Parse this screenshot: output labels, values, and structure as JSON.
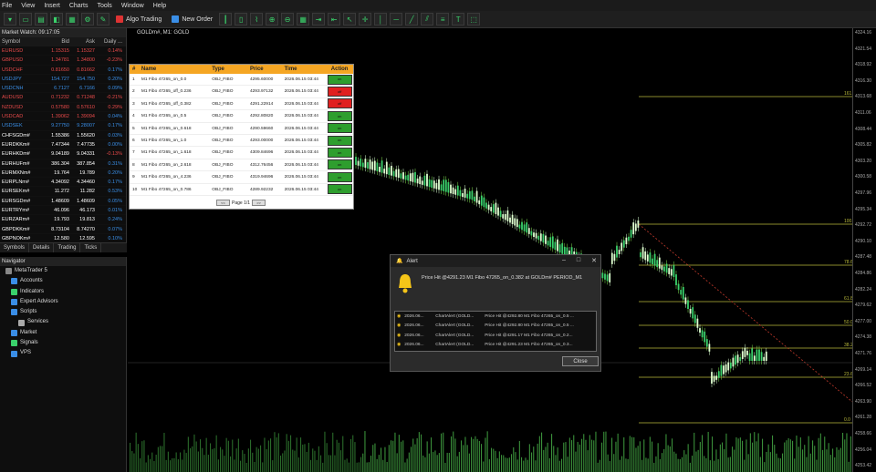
{
  "menu": [
    "File",
    "View",
    "Insert",
    "Charts",
    "Tools",
    "Window",
    "Help"
  ],
  "toolbar": {
    "algo_label": "Algo Trading",
    "neworder_label": "New Order"
  },
  "market_watch": {
    "title": "Market Watch: 09:17:05",
    "headers": [
      "Symbol",
      "Bid",
      "Ask",
      "Daily ..."
    ],
    "rows": [
      {
        "symbol": "EURUSD",
        "bid": "1.15315",
        "ask": "1.15327",
        "daily": "0.14%",
        "c": "#e84a4a",
        "dc": "#e84a4a"
      },
      {
        "symbol": "GBPUSD",
        "bid": "1.34781",
        "ask": "1.34800",
        "daily": "-0.23%",
        "c": "#e84a4a",
        "dc": "#e84a4a"
      },
      {
        "symbol": "USDCHF",
        "bid": "0.81650",
        "ask": "0.81662",
        "daily": "0.17%",
        "c": "#e84a4a",
        "dc": "#3a8ee6"
      },
      {
        "symbol": "USDJPY",
        "bid": "154.727",
        "ask": "154.750",
        "daily": "0.20%",
        "c": "#3a8ee6",
        "dc": "#3a8ee6"
      },
      {
        "symbol": "USDCNH",
        "bid": "6.7127",
        "ask": "6.7166",
        "daily": "0.09%",
        "c": "#3a8ee6",
        "dc": "#3a8ee6"
      },
      {
        "symbol": "AUDUSD",
        "bid": "0.71232",
        "ask": "0.71248",
        "daily": "-0.21%",
        "c": "#e84a4a",
        "dc": "#e84a4a"
      },
      {
        "symbol": "NZDUSD",
        "bid": "0.57580",
        "ask": "0.57610",
        "daily": "0.29%",
        "c": "#e84a4a",
        "dc": "#e84a4a"
      },
      {
        "symbol": "USDCAD",
        "bid": "1.39062",
        "ask": "1.39094",
        "daily": "0.04%",
        "c": "#e84a4a",
        "dc": "#3a8ee6"
      },
      {
        "symbol": "USDSEK",
        "bid": "9.27750",
        "ask": "9.28007",
        "daily": "0.17%",
        "c": "#3a8ee6",
        "dc": "#3a8ee6"
      },
      {
        "symbol": "CHFSGDm#",
        "bid": "1.55386",
        "ask": "1.55620",
        "daily": "0.03%",
        "c": "#ffffff",
        "dc": "#3a8ee6"
      },
      {
        "symbol": "EURDKKm#",
        "bid": "7.47344",
        "ask": "7.47735",
        "daily": "0.00%",
        "c": "#ffffff",
        "dc": "#3a8ee6"
      },
      {
        "symbol": "EURHKDm#",
        "bid": "9.04189",
        "ask": "9.04331",
        "daily": "-0.13%",
        "c": "#ffffff",
        "dc": "#e84a4a"
      },
      {
        "symbol": "EURHUFm#",
        "bid": "386.304",
        "ask": "387.854",
        "daily": "0.31%",
        "c": "#ffffff",
        "dc": "#3a8ee6"
      },
      {
        "symbol": "EURMXNm#",
        "bid": "19.764",
        "ask": "19.789",
        "daily": "0.20%",
        "c": "#ffffff",
        "dc": "#3a8ee6"
      },
      {
        "symbol": "EURPLNm#",
        "bid": "4.34092",
        "ask": "4.34460",
        "daily": "0.17%",
        "c": "#ffffff",
        "dc": "#3a8ee6"
      },
      {
        "symbol": "EURSEKm#",
        "bid": "11.272",
        "ask": "11.282",
        "daily": "0.53%",
        "c": "#ffffff",
        "dc": "#3a8ee6"
      },
      {
        "symbol": "EURSGDm#",
        "bid": "1.48609",
        "ask": "1.48609",
        "daily": "0.05%",
        "c": "#ffffff",
        "dc": "#3a8ee6"
      },
      {
        "symbol": "EURTRYm#",
        "bid": "46.096",
        "ask": "46.173",
        "daily": "0.01%",
        "c": "#ffffff",
        "dc": "#3a8ee6"
      },
      {
        "symbol": "EURZARm#",
        "bid": "19.793",
        "ask": "19.813",
        "daily": "0.24%",
        "c": "#ffffff",
        "dc": "#3a8ee6"
      },
      {
        "symbol": "GBPDKKm#",
        "bid": "8.73104",
        "ask": "8.74270",
        "daily": "0.07%",
        "c": "#ffffff",
        "dc": "#3a8ee6"
      },
      {
        "symbol": "GBPNOKm#",
        "bid": "12.580",
        "ask": "12.595",
        "daily": "0.10%",
        "c": "#ffffff",
        "dc": "#3a8ee6"
      }
    ],
    "tabs": [
      "Symbols",
      "Details",
      "Trading",
      "Ticks"
    ]
  },
  "navigator": {
    "title": "Navigator",
    "items": [
      {
        "label": "MetaTrader 5",
        "icon": "#888",
        "indent": 6
      },
      {
        "label": "Accounts",
        "icon": "#3a8ee6",
        "indent": 12
      },
      {
        "label": "Indicators",
        "icon": "#3ad16b",
        "indent": 12
      },
      {
        "label": "Expert Advisors",
        "icon": "#3a8ee6",
        "indent": 12
      },
      {
        "label": "Scripts",
        "icon": "#3a8ee6",
        "indent": 12
      },
      {
        "label": "Services",
        "icon": "#aaa",
        "indent": 20
      },
      {
        "label": "Market",
        "icon": "#3a8ee6",
        "indent": 12
      },
      {
        "label": "Signals",
        "icon": "#3ad16b",
        "indent": 12
      },
      {
        "label": "VPS",
        "icon": "#3a8ee6",
        "indent": 12
      }
    ]
  },
  "chart": {
    "label": "GOLDm#, M1: GOLD"
  },
  "fib_table": {
    "headers": [
      "#",
      "Name",
      "Type",
      "Price",
      "Time",
      "Action"
    ],
    "rows": [
      {
        "n": "1",
        "name": "M1 Fibo 47265_on_0.0",
        "type": "OBJ_FIBO",
        "price": "4295.60000",
        "time": "2026.06.15 03:44",
        "action": "on",
        "color": "#2e9e2e"
      },
      {
        "n": "2",
        "name": "M1 Fibo 47265_off_0.236",
        "type": "OBJ_FIBO",
        "price": "4293.97132",
        "time": "2026.06.15 03:44",
        "action": "off",
        "color": "#e02020"
      },
      {
        "n": "3",
        "name": "M1 Fibo 47265_off_0.382",
        "type": "OBJ_FIBO",
        "price": "4291.22914",
        "time": "2026.06.15 03:44",
        "action": "off",
        "color": "#e02020"
      },
      {
        "n": "4",
        "name": "M1 Fibo 47265_on_0.5",
        "type": "OBJ_FIBO",
        "price": "4292.80820",
        "time": "2026.06.15 03:44",
        "action": "on",
        "color": "#2e9e2e"
      },
      {
        "n": "5",
        "name": "M1 Fibo 47265_on_0.618",
        "type": "OBJ_FIBO",
        "price": "4290.59660",
        "time": "2026.06.15 03:44",
        "action": "on",
        "color": "#2e9e2e"
      },
      {
        "n": "6",
        "name": "M1 Fibo 47265_on_1.0",
        "type": "OBJ_FIBO",
        "price": "4293.00000",
        "time": "2026.06.15 03:44",
        "action": "on",
        "color": "#2e9e2e"
      },
      {
        "n": "7",
        "name": "M1 Fibo 47265_on_1.618",
        "type": "OBJ_FIBO",
        "price": "4309.84696",
        "time": "2026.06.15 03:44",
        "action": "on",
        "color": "#2e9e2e"
      },
      {
        "n": "8",
        "name": "M1 Fibo 47265_on_2.618",
        "type": "OBJ_FIBO",
        "price": "4312.76456",
        "time": "2026.06.15 03:44",
        "action": "on",
        "color": "#2e9e2e"
      },
      {
        "n": "9",
        "name": "M1 Fibo 47265_on_4.236",
        "type": "OBJ_FIBO",
        "price": "4319.94696",
        "time": "2026.06.15 03:44",
        "action": "on",
        "color": "#2e9e2e"
      },
      {
        "n": "10",
        "name": "M1 Fibo 47265_on_0.786",
        "type": "OBJ_FIBO",
        "price": "4289.92232",
        "time": "2026.06.15 03:44",
        "action": "on",
        "color": "#2e9e2e"
      }
    ],
    "pager": {
      "prev": "<<",
      "label": "Page 1/1",
      "next": ">>"
    }
  },
  "alert": {
    "title": "Alert",
    "message": "Price Hit @4291.23 M1 Fibo 47265_on_0.382 at GOLDm# PERIOD_M1",
    "list": [
      {
        "d": "2026.06...",
        "s": "ChartAlert (GOLD...",
        "m": "Price Hit @4292.80 M1 Fibo 47265_on_0.5 ..."
      },
      {
        "d": "2026.06...",
        "s": "ChartAlert (GOLD...",
        "m": "Price Hit @4292.80 M1 Fibo 47265_on_0.5 ..."
      },
      {
        "d": "2026.06...",
        "s": "ChartAlert (GOLD...",
        "m": "Price Hit @4291.17 M1 Fibo 47265_on_0.2..."
      },
      {
        "d": "2026.06...",
        "s": "ChartAlert (GOLD...",
        "m": "Price Hit @4291.23 M1 Fibo 47265_on_0.3..."
      }
    ],
    "close_label": "Close"
  },
  "price_axis": [
    "4324.16",
    "4321.54",
    "4318.92",
    "4316.30",
    "4313.68",
    "4311.06",
    "4308.44",
    "4305.82",
    "4303.20",
    "4300.58",
    "4297.96",
    "4295.34",
    "4292.72",
    "4290.10",
    "4287.48",
    "4284.86",
    "4282.24",
    "4279.62",
    "4277.00",
    "4274.38",
    "4271.76",
    "4269.14",
    "4266.52",
    "4263.90",
    "4261.28",
    "4258.66",
    "4256.04",
    "4253.42"
  ],
  "fib_levels": [
    "161.8",
    "100.0",
    "78.6",
    "61.8",
    "50.0",
    "38.2",
    "23.6",
    "0.0"
  ]
}
